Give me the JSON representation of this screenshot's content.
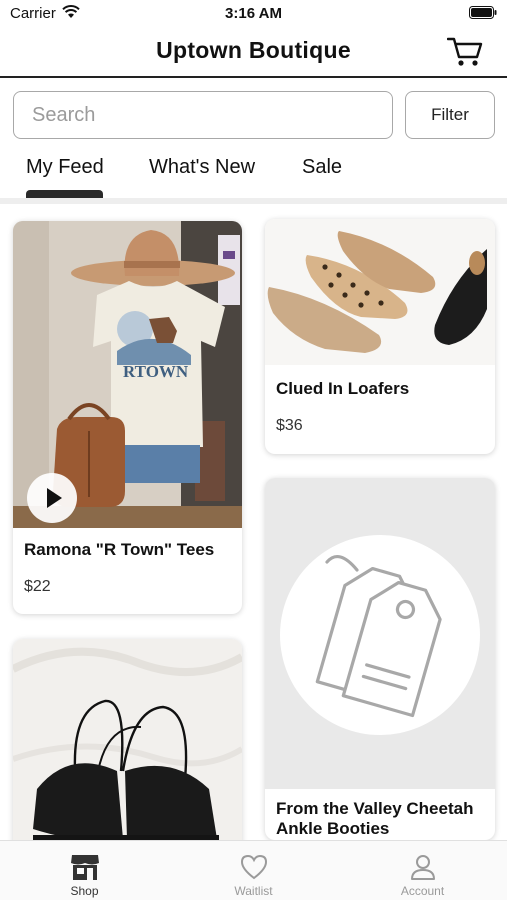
{
  "status_bar": {
    "carrier": "Carrier",
    "time": "3:16 AM"
  },
  "header": {
    "title": "Uptown Boutique",
    "cart_icon": "cart-icon"
  },
  "search": {
    "placeholder": "Search",
    "value": "",
    "filter_label": "Filter"
  },
  "tabs": [
    {
      "label": "My Feed",
      "active": true
    },
    {
      "label": "What's New",
      "active": false
    },
    {
      "label": "Sale",
      "active": false
    }
  ],
  "products": [
    {
      "name": "Ramona \"R Town\" Tees",
      "price": "$22",
      "has_video": true
    },
    {
      "name": "Clued In Loafers",
      "price": "$36",
      "has_video": false
    },
    {
      "name": "From the Valley Cheetah Ankle Booties",
      "price": "",
      "has_video": false
    },
    {
      "name": "",
      "price": "",
      "has_video": false
    }
  ],
  "tab_bar": [
    {
      "label": "Shop",
      "icon": "shop-icon",
      "active": true
    },
    {
      "label": "Waitlist",
      "icon": "heart-icon",
      "active": false
    },
    {
      "label": "Account",
      "icon": "person-icon",
      "active": false
    }
  ],
  "colors": {
    "accent": "#2a2a2a",
    "inactive": "#9a9a9a",
    "placeholder_bg": "#e9e9e9"
  }
}
